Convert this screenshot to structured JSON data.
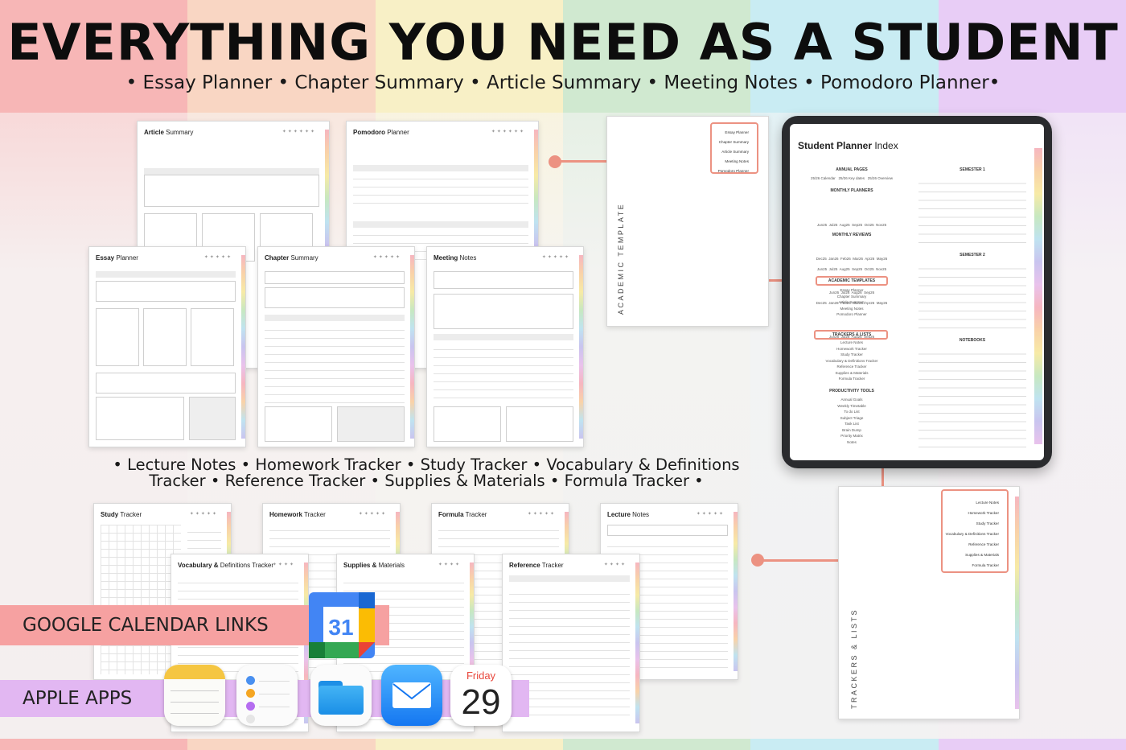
{
  "header": {
    "headline": "EVERYTHING YOU NEED AS A STUDENT",
    "subline": "• Essay Planner • Chapter Summary • Article Summary • Meeting Notes • Pomodoro Planner•",
    "midline_1": "• Lecture Notes • Homework Tracker • Study Tracker • Vocabulary & Definitions",
    "midline_2": "Tracker • Reference Tracker • Supplies & Materials • Formula Tracker •"
  },
  "pages_top": [
    {
      "bold": "Article",
      "rest": " Summary"
    },
    {
      "bold": "Pomodoro",
      "rest": " Planner"
    },
    {
      "bold": "Essay",
      "rest": " Planner"
    },
    {
      "bold": "Chapter",
      "rest": " Summary"
    },
    {
      "bold": "Meeting",
      "rest": " Notes"
    }
  ],
  "pages_bottom": [
    {
      "bold": "Study",
      "rest": " Tracker"
    },
    {
      "bold": "Homework",
      "rest": " Tracker"
    },
    {
      "bold": "Formula",
      "rest": " Tracker"
    },
    {
      "bold": "Lecture",
      "rest": " Notes"
    },
    {
      "bold": "Vocabulary &",
      "rest": " Definitions Tracker"
    },
    {
      "bold": "Supplies &",
      "rest": " Materials"
    },
    {
      "bold": "Reference",
      "rest": " Tracker"
    }
  ],
  "academic_page": {
    "vertical_label": "ACADEMIC TEMPLATE",
    "items": [
      "Essay Planner",
      "Chapter Summary",
      "Article Summary",
      "Meeting Notes",
      "Pomodoro Planner"
    ]
  },
  "trackers_page": {
    "vertical_label": "TRACKERS & LISTS",
    "items": [
      "Lecture Notes",
      "Homework Tracker",
      "Study Tracker",
      "Vocabulary & Definitions Tracker",
      "Reference Tracker",
      "Supplies & Materials",
      "Formula Tracker"
    ]
  },
  "tablet": {
    "title_bold": "Student Planner",
    "title_rest": " Index",
    "annual_pages": "ANNUAL PAGES",
    "annual_items": "25/26 Calendar   25/26 Key dates   25/26 Overview",
    "monthly_planners": "MONTHLY PLANNERS",
    "monthly_planner_rows": [
      "Jun25  Jul25  Aug25  Sep25  Oct25  Nov25",
      "Dec25  Jan26  Feb26  Mar26  Apr26  May26",
      "Jun26  Jul26  Aug26  Sep26"
    ],
    "monthly_reviews": "MONTHLY REVIEWS",
    "monthly_review_rows": [
      "Jun25  Jul25  Aug25  Sep25  Oct25  Nov25",
      "Dec25  Jan26  Feb26  Mar26  Apr26  May26",
      "Jun26  Jul26  Aug26  Sep26"
    ],
    "academic_templates": "ACADEMIC TEMPLATES",
    "academic_items": [
      "Essay Planner",
      "Chapter Summary",
      "Article Summary",
      "Meeting Notes",
      "Pomodoro Planner"
    ],
    "trackers_lists": "TRACKERS & LISTS",
    "tracker_items": [
      "Lecture Notes",
      "Homework Tracker",
      "Study Tracker",
      "Vocabulary & Definitions Tracker",
      "Reference Tracker",
      "Supplies & Materials",
      "Formula Tracker"
    ],
    "productivity_tools": "PRODUCTIVITY TOOLS",
    "productivity_items": [
      "Annual Goals",
      "Weekly Timetable",
      "To do List",
      "Subject Triage",
      "Task List",
      "Brain Dump",
      "Priority Matrix",
      "Notes"
    ],
    "semester_1": "SEMESTER 1",
    "semester_2": "SEMESTER 2",
    "notebooks": "NOTEBOOKS"
  },
  "badges": {
    "google": "GOOGLE CALENDAR LINKS",
    "apple": "APPLE APPS"
  },
  "gcal_day": "31",
  "calendar_app": {
    "weekday": "Friday",
    "day": "29"
  },
  "colors": {
    "accent": "#ec9282",
    "stripes": [
      "#f7b7b7",
      "#f9d7c4",
      "#f8f0c4",
      "#cfe8cf",
      "#c8ecf3",
      "#cde3f7",
      "#e9cdf5"
    ]
  }
}
